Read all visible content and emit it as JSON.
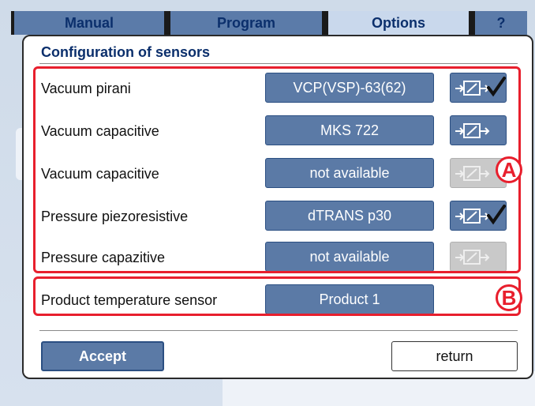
{
  "tabs": [
    {
      "label": "Manual",
      "active": false
    },
    {
      "label": "Program",
      "active": false
    },
    {
      "label": "Options",
      "active": true
    },
    {
      "label": "?",
      "active": false
    }
  ],
  "dialog": {
    "title": "Configuration of sensors",
    "sensors": [
      {
        "label": "Vacuum pirani",
        "model": "VCP(VSP)-63(62)",
        "icon": "sensor-connector-icon",
        "enabled": true,
        "checked": true
      },
      {
        "label": "Vacuum capacitive",
        "model": "MKS 722",
        "icon": "sensor-connector-icon",
        "enabled": true,
        "checked": false
      },
      {
        "label": "Vacuum capacitive",
        "model": "not available",
        "icon": "sensor-connector-icon",
        "enabled": false,
        "checked": false
      },
      {
        "label": "Pressure piezoresistive",
        "model": "dTRANS p30",
        "icon": "sensor-connector-icon",
        "enabled": true,
        "checked": true
      },
      {
        "label": "Pressure capazitive",
        "model": "not available",
        "icon": "sensor-connector-icon",
        "enabled": false,
        "checked": false
      }
    ],
    "product_sensor": {
      "label": "Product temperature sensor",
      "model": "Product 1"
    },
    "accept_label": "Accept",
    "return_label": "return"
  },
  "callouts": {
    "a": "A",
    "b": "B"
  },
  "colors": {
    "tab": "#5b7ba9",
    "tab_active": "#c9d8ec",
    "tab_text": "#0b2f6c",
    "button": "#5b7aa6",
    "button_disabled": "#c9c9c9",
    "highlight": "#e81f2d"
  }
}
